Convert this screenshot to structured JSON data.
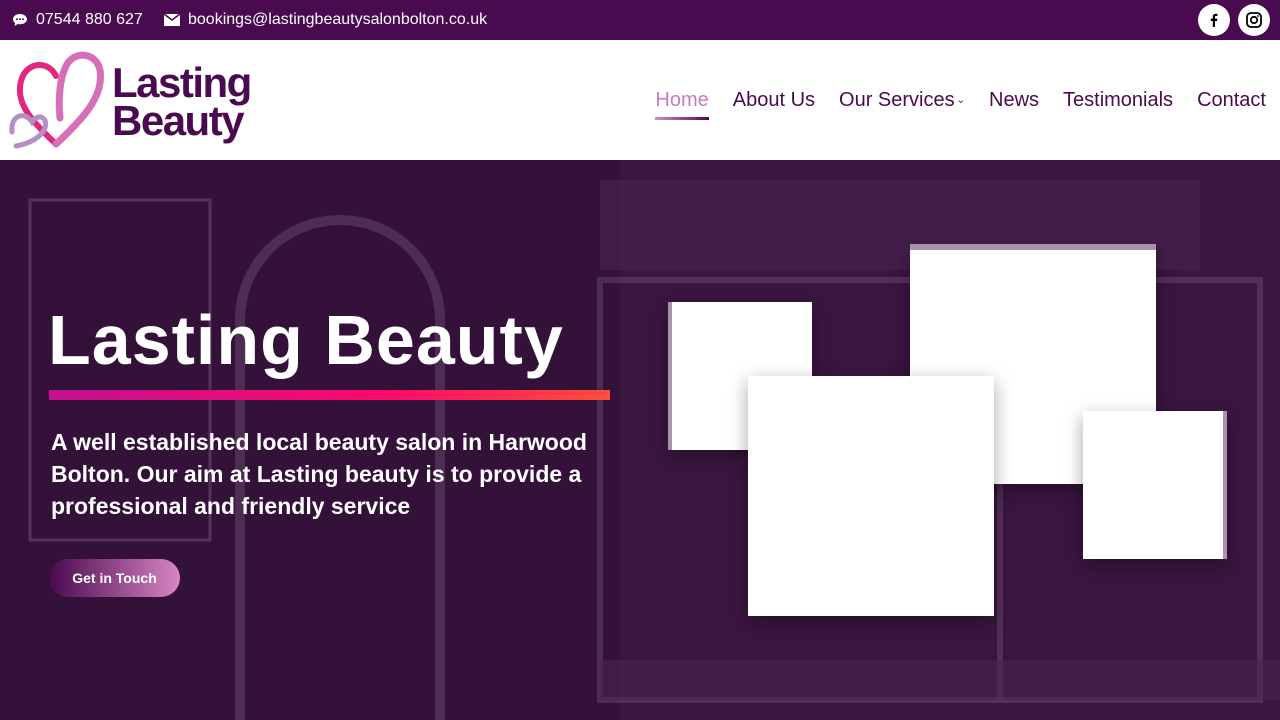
{
  "topbar": {
    "phone": "07544 880 627",
    "email": "bookings@lastingbeautysalonbolton.co.uk",
    "social": [
      "facebook-icon",
      "instagram-icon"
    ]
  },
  "logo": {
    "line1": "Lasting",
    "line2": "Beauty"
  },
  "nav": {
    "items": [
      "Home",
      "About Us",
      "Our Services",
      "News",
      "Testimonials",
      "Contact"
    ],
    "active": "Home"
  },
  "hero": {
    "title": "Lasting Beauty",
    "tagline": "A well established local beauty salon in Harwood Bolton. Our aim at Lasting beauty is to provide a professional and friendly service",
    "cta": "Get in Touch"
  },
  "colors": {
    "brand": "#4a0a4f",
    "accent_pink": "#d886c4",
    "bar_magenta": "#c2128f",
    "bar_red": "#ff4d3a"
  }
}
